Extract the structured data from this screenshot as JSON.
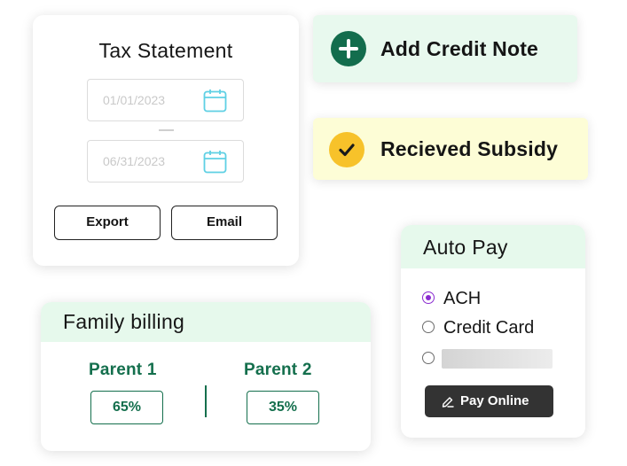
{
  "tax_statement": {
    "title": "Tax Statement",
    "start_date_placeholder": "01/01/2023",
    "end_date_placeholder": "06/31/2023",
    "export_label": "Export",
    "email_label": "Email"
  },
  "credit_note": {
    "label": "Add Credit Note",
    "icon": "plus-icon",
    "color": "#136d4d"
  },
  "subsidy": {
    "label": "Recieved Subsidy",
    "icon": "check-icon",
    "color": "#f7c22a"
  },
  "auto_pay": {
    "title": "Auto Pay",
    "options": [
      {
        "label": "ACH",
        "selected": true
      },
      {
        "label": "Credit Card",
        "selected": false
      },
      {
        "label": "",
        "selected": false
      }
    ],
    "pay_online_label": "Pay Online",
    "accent": "#8a2bd0"
  },
  "family_billing": {
    "title": "Family billing",
    "parents": [
      {
        "name": "Parent 1",
        "share": "65%"
      },
      {
        "name": "Parent 2",
        "share": "35%"
      }
    ],
    "accent": "#146f4d"
  }
}
